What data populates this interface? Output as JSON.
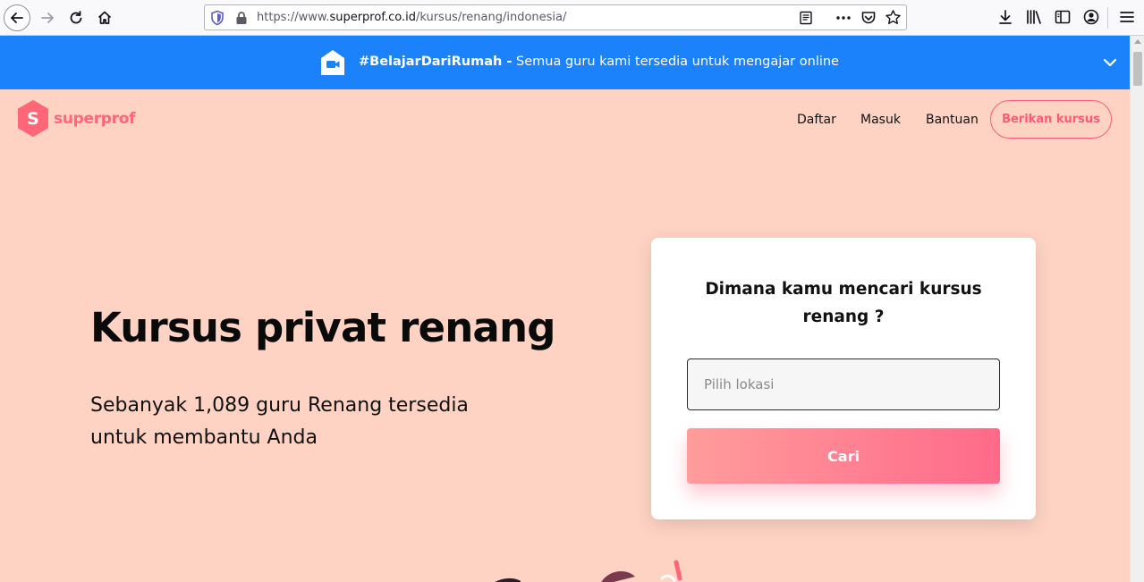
{
  "browser": {
    "url_prefix": "https://www.",
    "url_host": "superprof.co.id",
    "url_path": "/kursus/renang/indonesia/"
  },
  "banner": {
    "hashtag": "#BelajarDariRumah -",
    "message": " Semua guru kami tersedia untuk mengajar online",
    "background": "#1b82fb"
  },
  "header": {
    "logo_text": "superprof",
    "logo_letter": "S",
    "nav": [
      "Daftar",
      "Masuk",
      "Bantuan"
    ],
    "cta_label": "Berikan kursus"
  },
  "hero": {
    "title": "Kursus privat renang",
    "subtitle": "Sebanyak 1,089 guru Renang tersedia untuk membantu Anda"
  },
  "search_card": {
    "question": "Dimana kamu mencari kursus renang ?",
    "location_placeholder": "Pilih lokasi",
    "location_value": "",
    "submit_label": "Cari"
  },
  "colors": {
    "page_bg": "#fed3c3",
    "brand": "#ff6677",
    "cta_gradient_start": "#ff9c9c",
    "cta_gradient_end": "#ff6a89"
  }
}
